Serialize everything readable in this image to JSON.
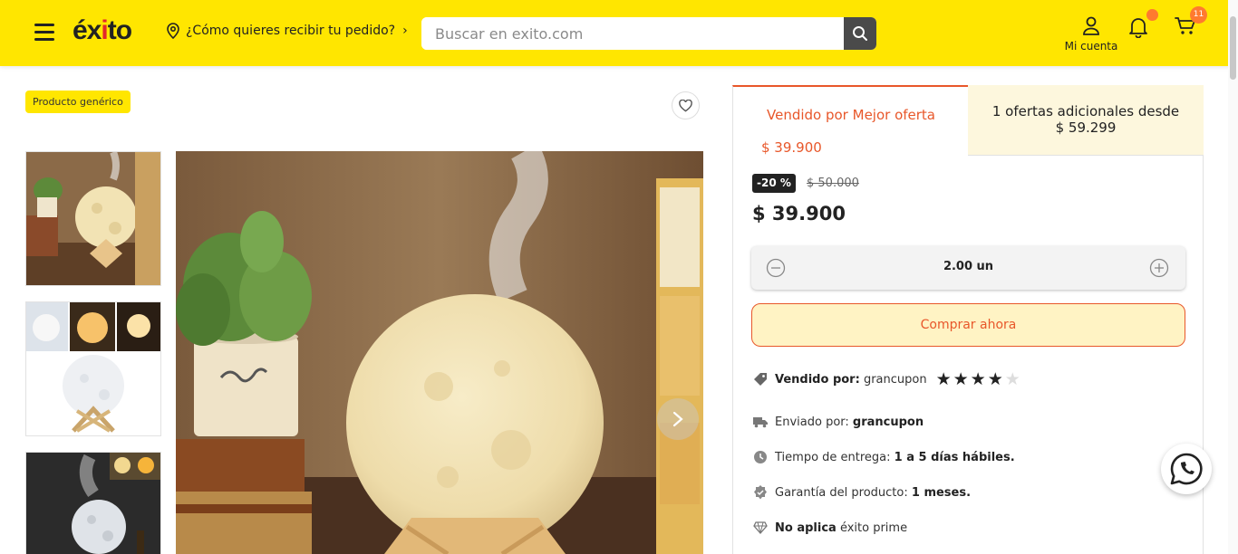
{
  "header": {
    "logo": "éxito",
    "location_text": "¿Cómo quieres recibir tu pedido?",
    "search_placeholder": "Buscar en exito.com",
    "account_label": "Mi cuenta",
    "cart_count": "11",
    "accent_color": "#ffe600",
    "badge_color": "#ff7a2f"
  },
  "product": {
    "tag": "Producto genérico",
    "thumbnails": [
      "moon-lamp-humidifier",
      "moon-lamp-variants",
      "moon-lamp-mist-dark"
    ],
    "main_image": "moon-lamp-humidifier-with-plant-and-books"
  },
  "offers": {
    "tab_seller": "Vendido por Mejor oferta",
    "tab_seller_price": "$ 39.900",
    "tab_additional": "1 ofertas adicionales desde $ 59.299"
  },
  "pricing": {
    "discount": "-20 %",
    "old_price": "$ 50.000",
    "price": "$ 39.900",
    "quantity": "2.00 un",
    "buy_label": "Comprar ahora"
  },
  "info": {
    "sold_by_label": "Vendido por:",
    "sold_by_value": "grancupon",
    "rating": 4,
    "rating_max": 5,
    "shipped_by_label": "Enviado por:",
    "shipped_by_value": "grancupon",
    "delivery_label": "Tiempo de entrega:",
    "delivery_value": "1 a 5 días hábiles.",
    "warranty_label": "Garantía del producto:",
    "warranty_value": "1 meses.",
    "prime_bold": "No aplica",
    "prime_rest": "éxito prime"
  },
  "colors": {
    "orange": "#e8572a",
    "cream": "#fdf7dd"
  }
}
